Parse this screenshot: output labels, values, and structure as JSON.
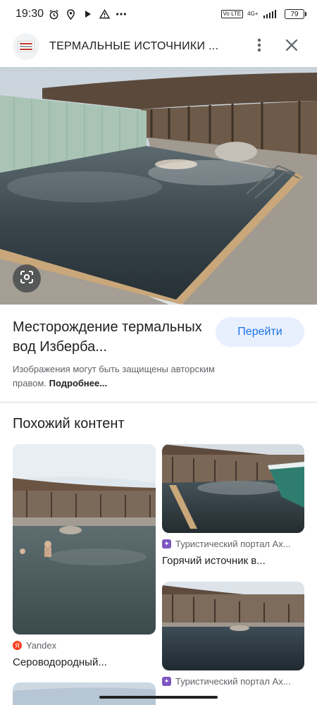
{
  "status_bar": {
    "time": "19:30",
    "network_label": "4G+",
    "volte_label": "Vo LTE",
    "battery": "79",
    "icons": [
      "alarm-icon",
      "location-icon",
      "play-icon",
      "warning-icon",
      "more-dots-icon"
    ]
  },
  "header": {
    "title": "ТЕРМАЛЬНЫЕ ИСТОЧНИКИ ...",
    "icons": [
      "site-logo-icon",
      "more-vert-icon",
      "close-icon"
    ]
  },
  "result": {
    "title": "Месторождение термальных вод Изберба...",
    "visit_label": "Перейти",
    "copyright_text": "Изображения могут быть защищены авторским правом. ",
    "copyright_more": "Подробнее..."
  },
  "similar": {
    "heading": "Похожий контент",
    "items": [
      {
        "source": "Yandex",
        "title": "Сероводородный...",
        "source_icon": "yandex-icon",
        "source_color": "#fc3f1d"
      },
      {
        "source": "Туристический портал Ах...",
        "title": "Горячий источник в...",
        "source_icon": "portal-icon",
        "source_color": "#7e57c2"
      },
      {
        "source": "Туристический портал Ах...",
        "title": "",
        "source_icon": "portal-icon",
        "source_color": "#7e57c2"
      }
    ]
  },
  "colors": {
    "accent": "#1a73e8",
    "button_bg": "#e8f0fe",
    "text_secondary": "#5f6368"
  }
}
